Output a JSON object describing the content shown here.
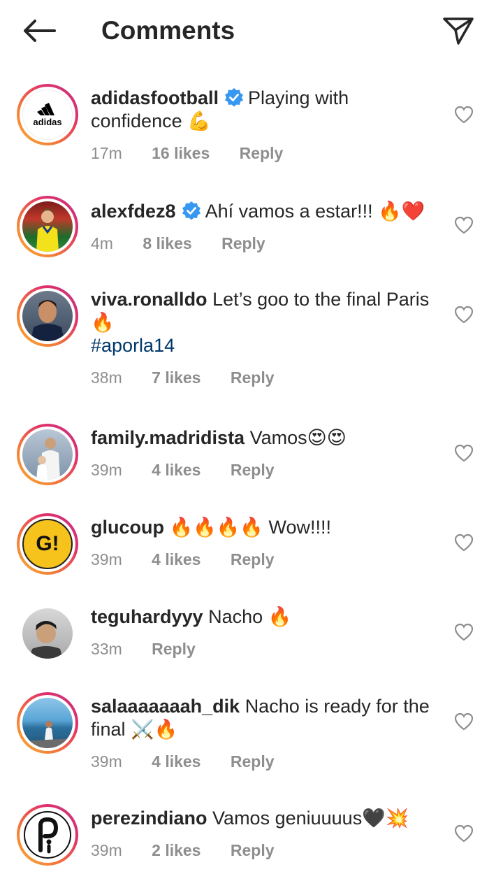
{
  "header": {
    "title": "Comments"
  },
  "comments": [
    {
      "username": "adidasfootball",
      "verified": true,
      "text": "Playing with confidence 💪",
      "hashtag": "",
      "time": "17m",
      "likes": "16 likes",
      "reply": "Reply",
      "avatar": "adidas-logo"
    },
    {
      "username": "alexfdez8",
      "verified": true,
      "text": "Ahí vamos a estar!!! 🔥❤️",
      "hashtag": "",
      "time": "4m",
      "likes": "8 likes",
      "reply": "Reply",
      "avatar": "player-photo"
    },
    {
      "username": "viva.ronalldo",
      "verified": false,
      "text": "Let’s goo to the final Paris 🔥",
      "hashtag": "#aporla14",
      "time": "38m",
      "likes": "7 likes",
      "reply": "Reply",
      "avatar": "player-photo"
    },
    {
      "username": "family.madridista",
      "verified": false,
      "text": "Vamos😍😍",
      "hashtag": "",
      "time": "39m",
      "likes": "4 likes",
      "reply": "Reply",
      "avatar": "player-photo"
    },
    {
      "username": "glucoup",
      "verified": false,
      "text": "🔥🔥🔥🔥 Wow!!!!",
      "hashtag": "",
      "time": "39m",
      "likes": "4 likes",
      "reply": "Reply",
      "avatar": "g-logo",
      "avatar_text": "G!"
    },
    {
      "username": "teguhardyyy",
      "verified": false,
      "text": "Nacho 🔥",
      "hashtag": "",
      "time": "33m",
      "likes": "",
      "reply": "Reply",
      "avatar": "person-photo"
    },
    {
      "username": "salaaaaaaah_dik",
      "verified": false,
      "text": "Nacho is ready for the final ⚔️🔥",
      "hashtag": "",
      "time": "39m",
      "likes": "4 likes",
      "reply": "Reply",
      "avatar": "sea-photo"
    },
    {
      "username": "perezindiano",
      "verified": false,
      "text": "Vamos geniuuuus🖤💥",
      "hashtag": "",
      "time": "39m",
      "likes": "2 likes",
      "reply": "Reply",
      "avatar": "pi-logo"
    }
  ],
  "colors": {
    "text": "#262626",
    "muted": "#8e8e8e",
    "hashtag": "#00376b",
    "verified": "#3897f0",
    "glucoup_yellow": "#f6c21c"
  }
}
